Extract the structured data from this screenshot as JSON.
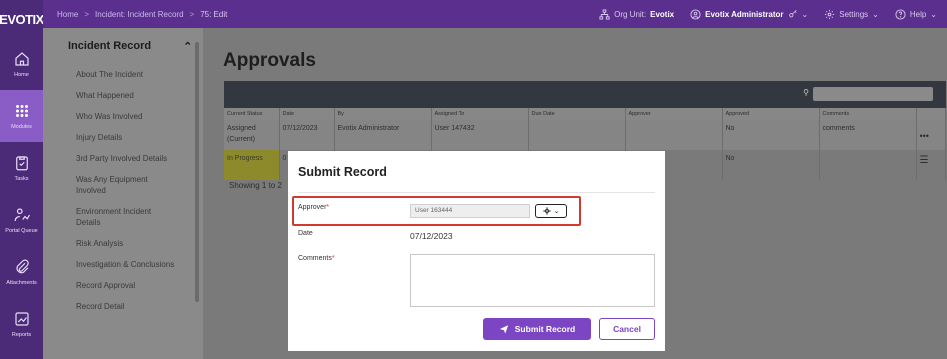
{
  "brand": "EVOTIX",
  "rail": [
    {
      "label": "Home",
      "icon": "home-icon",
      "active": false
    },
    {
      "label": "Modules",
      "icon": "grid-icon",
      "active": true
    },
    {
      "label": "Tasks",
      "icon": "clipboard-icon",
      "active": false
    },
    {
      "label": "Portal Queue",
      "icon": "portal-queue-icon",
      "active": false
    },
    {
      "label": "Attachments",
      "icon": "paperclip-icon",
      "active": false
    },
    {
      "label": "Reports",
      "icon": "reports-icon",
      "active": false
    }
  ],
  "breadcrumb": {
    "home": "Home",
    "record": "Incident: Incident Record",
    "edit": "75: Edit"
  },
  "topbar": {
    "org_label": "Org Unit:",
    "org_value": "Evotix",
    "user": "Evotix Administrator",
    "settings": "Settings",
    "help": "Help"
  },
  "secnav": {
    "title": "Incident Record",
    "items": [
      "About The Incident",
      "What Happened",
      "Who Was Involved",
      "Injury Details",
      "3rd Party Involved Details",
      "Was Any Equipment Involved",
      "Environment Incident Details",
      "Risk Analysis",
      "Investigation & Conclusions",
      "Record Approval",
      "Record Detail"
    ]
  },
  "main": {
    "title": "Approvals",
    "table": {
      "headers": [
        "Current Status",
        "Date",
        "By",
        "Assigned To",
        "Due Date",
        "Approver",
        "Approved",
        "Comments",
        ""
      ],
      "rows": [
        [
          "Assigned (Current)",
          "07/12/2023",
          "Evotix Administrator",
          "User 147432",
          "",
          "",
          "No",
          "comments",
          ""
        ],
        [
          "In Progress",
          "0",
          "",
          "",
          "",
          "",
          "No",
          "",
          ""
        ]
      ]
    },
    "showing": "Showing 1 to 2"
  },
  "modal": {
    "title": "Submit Record",
    "approver_label": "Approver",
    "approver_value": "User 163444",
    "date_label": "Date",
    "date_value": "07/12/2023",
    "comments_label": "Comments",
    "submit_label": "Submit Record",
    "cancel_label": "Cancel"
  },
  "colors": {
    "brand": "#5a2f8e",
    "accent": "#7b45c4",
    "required": "#d33a2f",
    "highlight": "#d33a2f"
  }
}
